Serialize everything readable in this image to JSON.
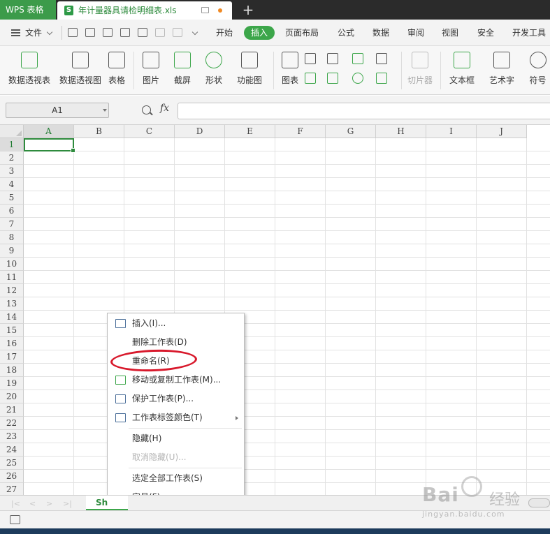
{
  "titlebar": {
    "app_name": "WPS 表格",
    "document_name": "年计量器具请检明细表.xls",
    "s_logo": "S"
  },
  "menubar": {
    "file": "文件",
    "tabs": [
      "开始",
      "插入",
      "页面布局",
      "公式",
      "数据",
      "审阅",
      "视图",
      "安全",
      "开发工具"
    ],
    "active_tab": "插入"
  },
  "ribbon": {
    "pivot_table": "数据透视表",
    "pivot_chart": "数据透视图",
    "table": "表格",
    "picture": "图片",
    "screenshot": "截屏",
    "shapes": "形状",
    "function_chart": "功能图",
    "chart": "图表",
    "slicer": "切片器",
    "textbox": "文本框",
    "wordart": "艺术字",
    "symbol": "符号"
  },
  "formulabar": {
    "name_box": "A1",
    "fx": "fx",
    "formula": ""
  },
  "grid": {
    "columns": [
      "A",
      "B",
      "C",
      "D",
      "E",
      "F",
      "G",
      "H",
      "I",
      "J"
    ],
    "rows": [
      "1",
      "2",
      "3",
      "4",
      "5",
      "6",
      "7",
      "8",
      "9",
      "10",
      "11",
      "12",
      "13",
      "14",
      "15",
      "16",
      "17",
      "18",
      "19",
      "20",
      "21",
      "22",
      "23",
      "24",
      "25",
      "26",
      "27"
    ],
    "active_column": "A",
    "active_row": "1"
  },
  "sheet_tab": {
    "label": "Sh"
  },
  "context_menu": {
    "insert": "插入(I)...",
    "delete_sheet": "删除工作表(D)",
    "rename": "重命名(R)",
    "move_copy": "移动或复制工作表(M)...",
    "protect": "保护工作表(P)...",
    "tab_color": "工作表标签颜色(T)",
    "hide": "隐藏(H)",
    "unhide": "取消隐藏(U)...",
    "select_all": "选定全部工作表(S)",
    "font_size": "字号(F)"
  },
  "watermark": {
    "logo": "Bai",
    "cn": "经验",
    "url": "jingyan.baidu.com"
  },
  "colors": {
    "accent_green": "#3ca64a",
    "annotation_red": "#d8192c"
  }
}
